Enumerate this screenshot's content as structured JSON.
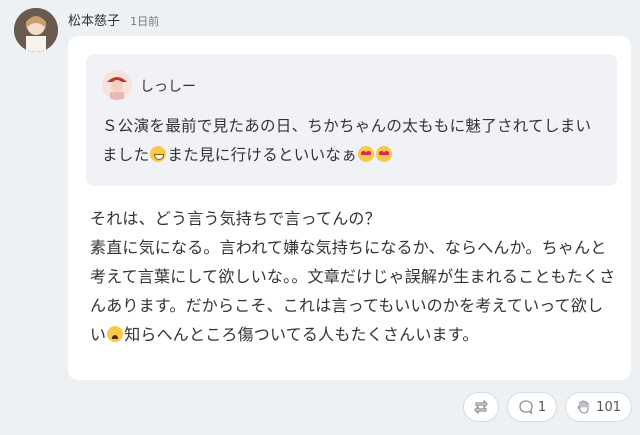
{
  "post": {
    "author": "松本慈子",
    "time": "1日前"
  },
  "quote": {
    "author": "しっしー",
    "text_part1": "Ｓ公演を最前で見たあの日、ちかちゃんの太ももに魅了されてしまいました",
    "text_part2": "また見に行けるといいなぁ"
  },
  "body": {
    "line1": "それは、どう言う気持ちで言ってんの？",
    "line2": "素直に気になる。言われて嫌な気持ちになるか、ならへんか。ちゃんと考えて言葉にして欲しいな。。文章だけじゃ誤解が生まれることもたくさんあります。だからこそ、これは言ってもいいのかを考えていって欲しい",
    "line3": "知らへんところ傷ついてる人もたくさんいます。"
  },
  "actions": {
    "repost_icon": "repost-icon",
    "reply_icon": "reply-icon",
    "reply_count": "1",
    "clap_icon": "clap-icon",
    "clap_count": "101"
  },
  "colors": {
    "background": "#eef1f4",
    "card": "#ffffff",
    "quote": "#f0f2f5"
  }
}
